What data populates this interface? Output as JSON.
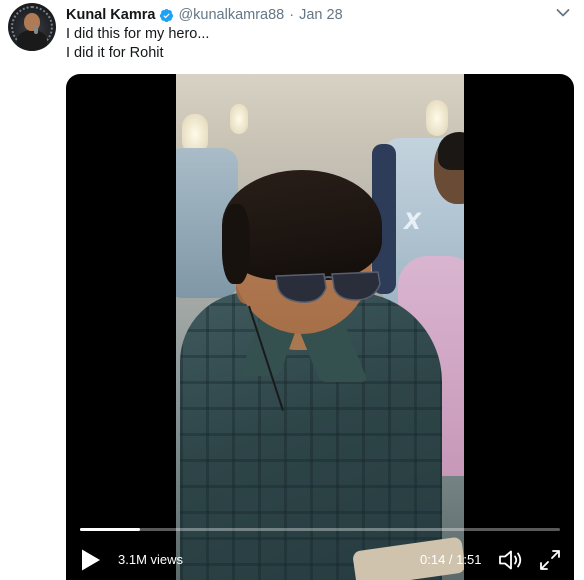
{
  "author": {
    "name": "Kunal Kamra",
    "handle": "@kunalkamra88",
    "separator": "·",
    "date": "Jan 28",
    "verified": true
  },
  "tweet": {
    "lines": [
      "I did this for my hero...",
      "I did it for Rohit"
    ]
  },
  "video": {
    "views": "3.1M views",
    "time": "0:14 / 1:51",
    "progress_fraction": 0.126
  },
  "icons": {
    "verified": "verified-badge-icon",
    "more": "chevron-down-icon",
    "play": "play-icon",
    "volume": "volume-icon",
    "fullscreen": "fullscreen-icon"
  },
  "colors": {
    "text": "#14171a",
    "secondary": "#657786",
    "verified": "#1da1f2",
    "video_bg": "#000000"
  }
}
